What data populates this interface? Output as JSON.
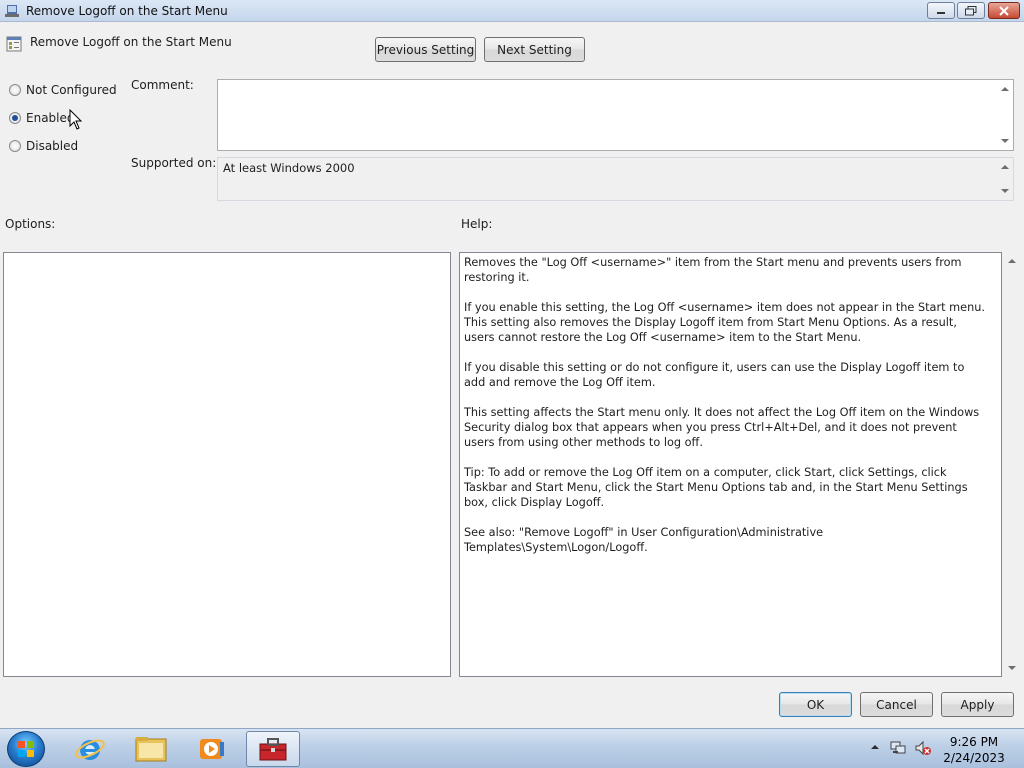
{
  "window": {
    "title": "Remove Logoff on the Start Menu"
  },
  "header": {
    "policy_title": "Remove Logoff on the Start Menu",
    "previous_label": "Previous Setting",
    "next_label": "Next Setting"
  },
  "state": {
    "options": [
      {
        "label": "Not Configured",
        "checked": false
      },
      {
        "label": "Enabled",
        "checked": true
      },
      {
        "label": "Disabled",
        "checked": false
      }
    ]
  },
  "comment": {
    "label": "Comment:",
    "value": ""
  },
  "supported": {
    "label": "Supported on:",
    "value": "At least Windows 2000"
  },
  "options_panel": {
    "label": "Options:"
  },
  "help": {
    "label": "Help:",
    "paragraphs": [
      "Removes the \"Log Off <username>\" item from the Start menu and prevents users from restoring it.",
      "If you enable this setting, the Log Off <username> item does not appear in the Start menu. This setting also removes the Display Logoff item from Start Menu Options. As a result, users cannot restore the Log Off <username> item to the Start Menu.",
      "If you disable this setting or do not configure it, users can use the Display Logoff item to add and remove the Log Off item.",
      "This setting affects the Start menu only. It does not affect the Log Off item on the Windows Security dialog box that appears when you press Ctrl+Alt+Del, and it does not prevent users from using other methods to log off.",
      "Tip: To add or remove the Log Off item on a computer, click Start, click Settings, click Taskbar and Start Menu, click the Start Menu Options tab and, in the Start Menu Settings box, click Display Logoff.",
      "See also: \"Remove Logoff\" in User Configuration\\Administrative Templates\\System\\Logon/Logoff."
    ]
  },
  "footer": {
    "ok_label": "OK",
    "cancel_label": "Cancel",
    "apply_label": "Apply"
  },
  "taskbar": {
    "items": [
      {
        "name": "internet-explorer-icon"
      },
      {
        "name": "windows-explorer-icon"
      },
      {
        "name": "media-player-icon"
      },
      {
        "name": "toolbox-icon"
      }
    ],
    "time": "9:26 PM",
    "date": "2/24/2023"
  }
}
